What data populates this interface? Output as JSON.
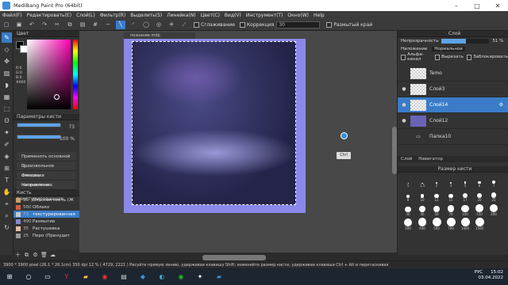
{
  "window": {
    "title": "MediBang Paint Pro (64bit)"
  },
  "menu": [
    "Файл(F)",
    "Редактировать(E)",
    "Слой(L)",
    "Фильтр(R)",
    "Выделить(S)",
    "Линейка(N)",
    "Цвет(C)",
    "Вид(V)",
    "Инструмент(T)",
    "Окно(W)",
    "Help"
  ],
  "toolbar": {
    "smoothing_label": "Сглаживание",
    "correction_label": "Коррекция",
    "correction_value": "30",
    "blur_edge_label": "Размытый край"
  },
  "color_panel": {
    "title": "Цвет",
    "rgb_lines": [
      "R:0",
      "G:0",
      "B:0",
      "#000"
    ]
  },
  "brush_params": {
    "title": "Параметры кисти",
    "size_value": "73",
    "opacity_value": "100 %",
    "options": [
      "Применить основной ц...",
      "Произвольное смещен...",
      "Фиксация направлени...",
      "Направление вращени..."
    ]
  },
  "brushes": {
    "title": "Кисть текстурированная",
    "items": [
      {
        "num": "35",
        "name": "Плоская кисть (Ж",
        "color": "#c9a06a"
      },
      {
        "num": "560",
        "name": "Облако",
        "color": "#d06040"
      },
      {
        "num": "73",
        "name": "текстурированная",
        "color": "#c8c8c8",
        "selected": true
      },
      {
        "num": "490",
        "name": "Размытие",
        "color": "#8888cc"
      },
      {
        "num": "35",
        "name": "Растушевка",
        "color": "#e8c0a0"
      },
      {
        "num": "25",
        "name": "Перо (Принудит",
        "color": "#999999"
      }
    ]
  },
  "document": {
    "tab": "познание.mdp"
  },
  "canvas": {
    "ctrl_hint": "Ctrl"
  },
  "layers": {
    "title": "Слой",
    "opacity_label": "Непрозрачность",
    "opacity_value": "51 %",
    "blend_label": "Наложение",
    "blend_value": "Нормальное",
    "alpha_label": "Альфа-канал",
    "clip_label": "Вырезать",
    "lock_label": "Заблокировать",
    "items": [
      {
        "name": "Temo",
        "visible": false,
        "selected": false
      },
      {
        "name": "Слой3",
        "visible": true,
        "selected": false
      },
      {
        "name": "Слой14",
        "visible": true,
        "selected": true
      },
      {
        "name": "Слой12",
        "visible": true,
        "selected": false
      },
      {
        "name": "Папка10",
        "visible": false,
        "selected": false
      }
    ]
  },
  "navigator": {
    "tab1": "Слой",
    "tab2": "Навигатор"
  },
  "brush_size": {
    "title": "Размер кисти",
    "sizes": [
      "1",
      "1.5",
      "2",
      "3",
      "5",
      "6",
      "7",
      "8",
      "10",
      "12",
      "15",
      "17",
      "20",
      "25",
      "30",
      "40",
      "50",
      "70",
      "100",
      "150",
      "200",
      "300",
      "400",
      "500",
      "700",
      "1000",
      "1500"
    ]
  },
  "statusbar": {
    "text": "3900 * 3900 pixel  (26.1 * 26.1cm)  350 dpi  12 %  ( 4729, 2221 )  Рисуйте прямую линию, удерживая клавишу Shift; изменяйте размер кисти, удерживая клавиши Ctrl + Alt и перетаскивая"
  },
  "taskbar": {
    "lang": "РУС",
    "time": "15:02",
    "date": "03.04.2022"
  }
}
